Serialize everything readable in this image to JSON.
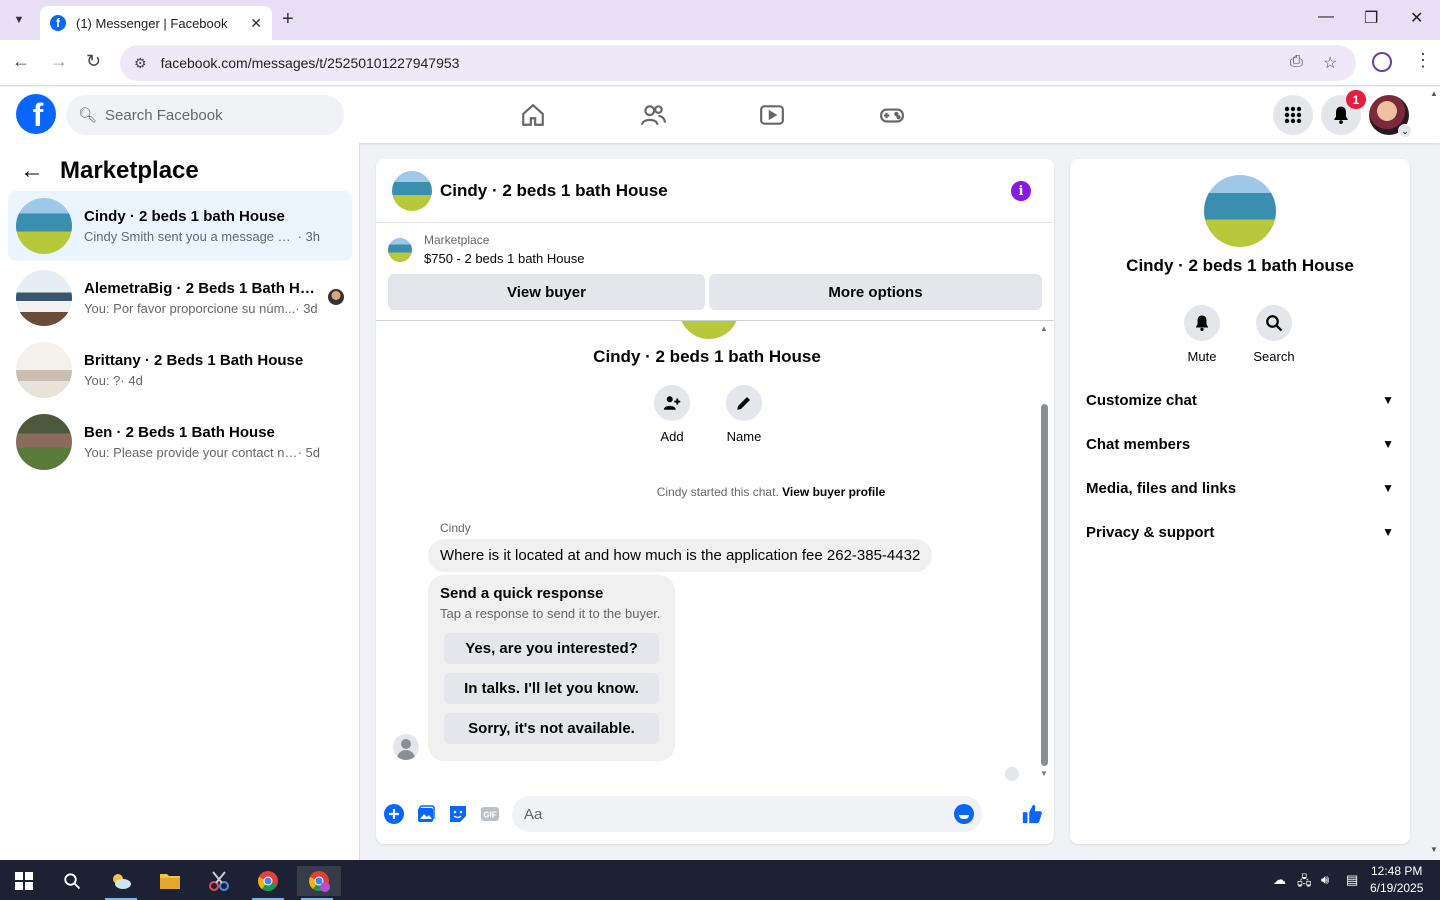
{
  "browser": {
    "tab_title": "(1) Messenger | Facebook",
    "url": "facebook.com/messages/t/25250101227947953"
  },
  "fb_header": {
    "search_placeholder": "Search Facebook",
    "notification_count": "1"
  },
  "left_panel": {
    "title": "Marketplace",
    "conversations": [
      {
        "name": "Cindy · 2 beds 1 bath House",
        "preview": "Cindy Smith sent you a message abou...",
        "time": " · 3h",
        "active": true
      },
      {
        "name": "AlemetraBig · 2 Beds 1 Bath Hou...",
        "preview": "You: Por favor proporcione su núm...",
        "time": " · 3d",
        "active": false
      },
      {
        "name": "Brittany · 2 Beds 1 Bath House",
        "preview": "You: ?",
        "time": " · 4d",
        "active": false
      },
      {
        "name": "Ben · 2 Beds 1 Bath House",
        "preview": "You: Please provide your contact num...",
        "time": " · 5d",
        "active": false
      }
    ]
  },
  "chat": {
    "title": "Cindy · 2 beds 1 bath House",
    "listing_label": "Marketplace",
    "listing_price": "$750 - 2 beds 1 bath House",
    "view_buyer": "View buyer",
    "more_options": "More options",
    "thread_title": "Cindy · 2 beds 1 bath House",
    "add_label": "Add",
    "name_label": "Name",
    "system_message": "Cindy started this chat.",
    "system_link": "View buyer profile",
    "sender": "Cindy",
    "message": "Where is it located at and how much is the application fee 262-385-4432",
    "quick_response": {
      "heading": "Send a quick response",
      "subtext": "Tap a response to send it to the buyer.",
      "options": [
        "Yes, are you interested?",
        "In talks. I'll let you know.",
        "Sorry, it's not available."
      ]
    },
    "composer_placeholder": "Aa"
  },
  "right_panel": {
    "name": "Cindy · 2 beds 1 bath House",
    "mute_label": "Mute",
    "search_label": "Search",
    "sections": [
      "Customize chat",
      "Chat members",
      "Media, files and links",
      "Privacy & support"
    ]
  },
  "taskbar": {
    "time": "12:48 PM",
    "date": "6/19/2025"
  },
  "colors": {
    "fb_blue": "#0866ff",
    "info_purple": "#8a16e8",
    "badge_red": "#e41e3f",
    "active_row": "#ebf5ff"
  }
}
